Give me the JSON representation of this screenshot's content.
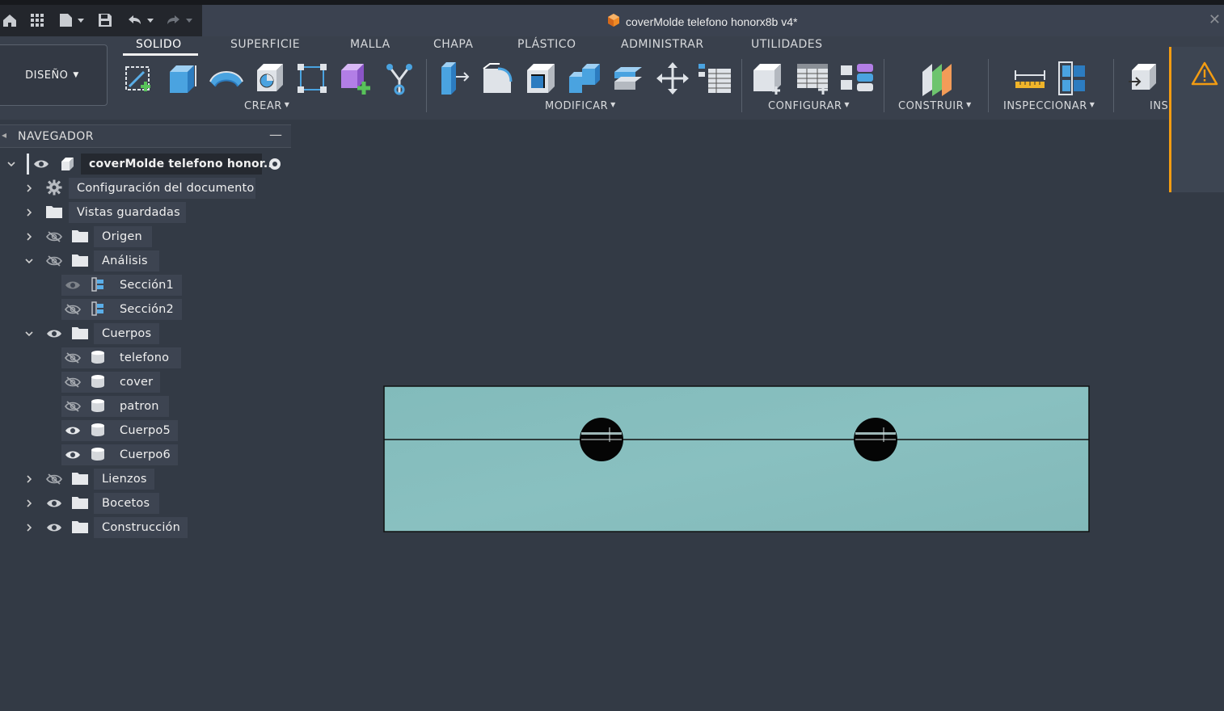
{
  "window": {
    "doc_title": "coverMolde telefono honorx8b v4*",
    "close_icon": "close-icon"
  },
  "ribbon": {
    "workspace": "DISEÑO",
    "tabs": [
      {
        "label": "SOLIDO",
        "active": true
      },
      {
        "label": "SUPERFICIE"
      },
      {
        "label": "MALLA"
      },
      {
        "label": "CHAPA"
      },
      {
        "label": "PLÁSTICO"
      },
      {
        "label": "ADMINISTRAR"
      },
      {
        "label": "UTILIDADES"
      }
    ],
    "groups": {
      "crear": "CREAR",
      "modificar": "MODIFICAR",
      "configurar": "CONFIGURAR",
      "construir": "CONSTRUIR",
      "inspeccionar": "INSPECCIONAR",
      "insertar": "INS"
    }
  },
  "navigator": {
    "title": "NAVEGADOR",
    "root": "coverMolde telefono honor...",
    "items": [
      {
        "label": "Configuración del documento"
      },
      {
        "label": "Vistas guardadas"
      },
      {
        "label": "Origen"
      },
      {
        "label": "Análisis"
      },
      {
        "label": "Sección1"
      },
      {
        "label": "Sección2"
      },
      {
        "label": "Cuerpos"
      },
      {
        "label": "telefono"
      },
      {
        "label": "cover"
      },
      {
        "label": "patron"
      },
      {
        "label": "Cuerpo5"
      },
      {
        "label": "Cuerpo6"
      },
      {
        "label": "Lienzos"
      },
      {
        "label": "Bocetos"
      },
      {
        "label": "Construcción"
      }
    ]
  },
  "colors": {
    "background": "#333a45",
    "model_fill": "#86bcbc",
    "accent_orange": "#f39c12",
    "icon_blue": "#5aaee8"
  }
}
